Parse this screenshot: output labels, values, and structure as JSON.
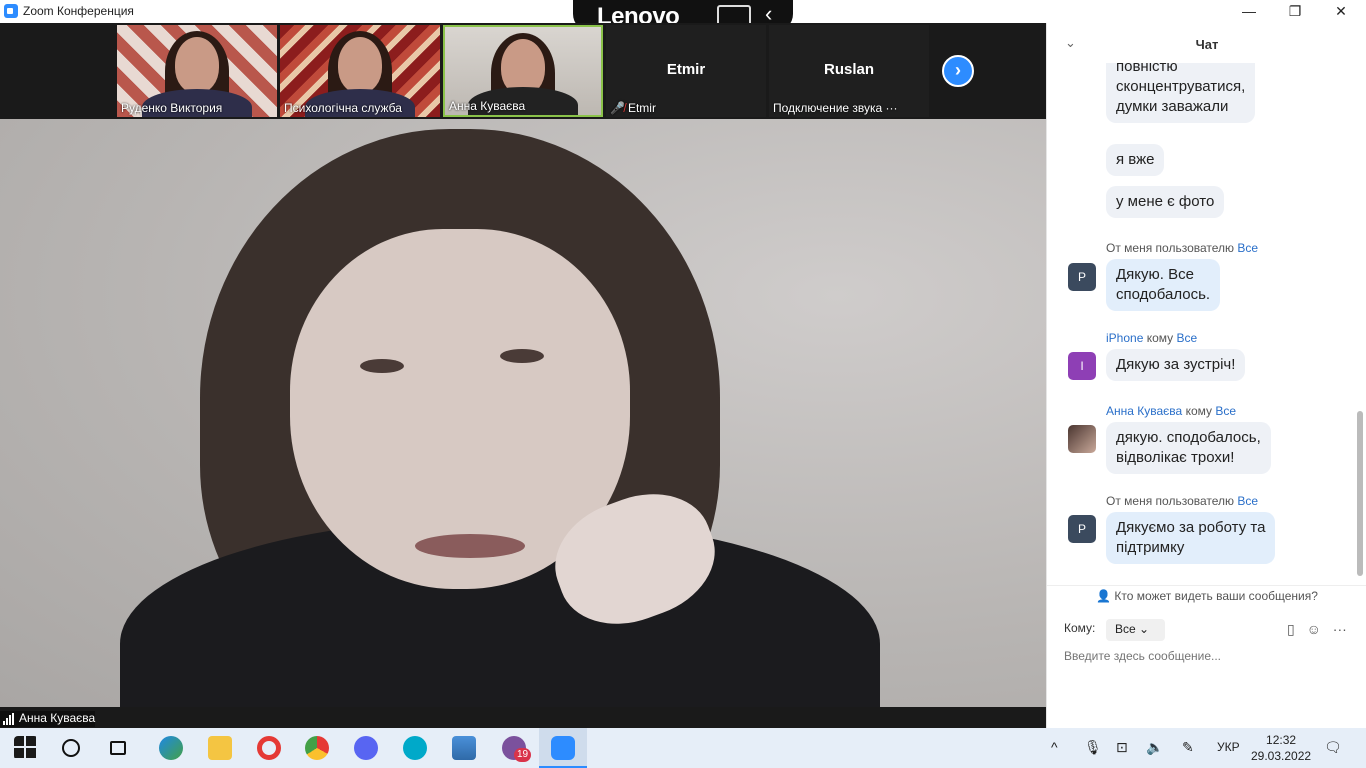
{
  "window": {
    "title": "Zoom Конференция",
    "minimize": "—",
    "maximize": "❐",
    "close": "✕"
  },
  "overlay": {
    "brand": "Lenovo"
  },
  "participants": [
    {
      "name": "Руденко Виктория"
    },
    {
      "name": "Психологічна служба"
    },
    {
      "name": "Анна Куваєва"
    },
    {
      "name": "Etmir",
      "display": "Etmir"
    },
    {
      "name": "Подключение звука ···",
      "display": "Ruslan"
    }
  ],
  "main_video": {
    "speaker": "Анна Куваєва"
  },
  "chat": {
    "title": "Чат",
    "messages": [
      {
        "text_line1": "повністю",
        "text_line2": "сконцентруватися,",
        "text_line3": "думки заважали"
      },
      {
        "text": "я вже"
      },
      {
        "text": "у мене є фото"
      },
      {
        "sender": "От меня пользователю",
        "recipient": "Все",
        "avatar": "P",
        "text_line1": "Дякую. Все",
        "text_line2": "сподобалось."
      },
      {
        "sender": "iPhone",
        "kom": "кому",
        "recipient": "Все",
        "avatar": "I",
        "text": "Дякую за зустріч!"
      },
      {
        "sender": "Анна Куваєва",
        "kom": "кому",
        "recipient": "Все",
        "text_line1": "дякую. сподобалось,",
        "text_line2": "відволікає трохи!"
      },
      {
        "sender": "От меня пользователю",
        "recipient": "Все",
        "avatar": "P",
        "text_line1": "Дякуємо за роботу та",
        "text_line2": "підтримку"
      }
    ],
    "visibility_note": "Кто может видеть ваши сообщения?",
    "to_label": "Кому:",
    "to_value": "Все",
    "input_placeholder": "Введите здесь сообщение..."
  },
  "taskbar": {
    "viber_badge": "19",
    "language": "УКР",
    "time": "12:32",
    "date": "29.03.2022"
  }
}
